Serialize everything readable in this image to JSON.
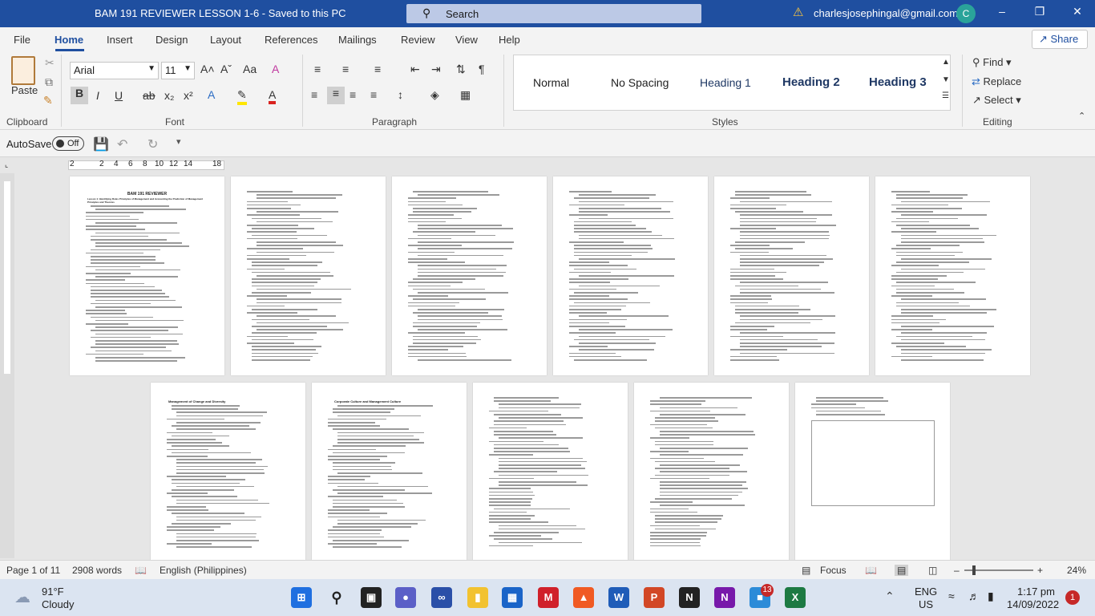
{
  "titlebar": {
    "doc_title": "BAM 191 REVIEWER LESSON 1-6  -  Saved to this PC",
    "search_label": "Search",
    "account_email": "charlesjosephingal@gmail.com",
    "avatar_initial": "C"
  },
  "menu": {
    "tabs": [
      "File",
      "Home",
      "Insert",
      "Design",
      "Layout",
      "References",
      "Mailings",
      "Review",
      "View",
      "Help"
    ],
    "share_label": "Share"
  },
  "ribbon": {
    "paste_label": "Paste",
    "font_name": "Arial",
    "font_size": "11",
    "styles": [
      "Normal",
      "No Spacing",
      "Heading 1",
      "Heading 2",
      "Heading 3"
    ],
    "editing": {
      "find": "Find",
      "replace": "Replace",
      "select": "Select"
    },
    "groups": [
      "Clipboard",
      "Font",
      "Paragraph",
      "Styles",
      "Editing"
    ]
  },
  "qat": {
    "autosave_label": "AutoSave",
    "autosave_state": "Off"
  },
  "ruler": {
    "labels": [
      "2",
      "2",
      "4",
      "6",
      "8",
      "10",
      "12",
      "14",
      "18"
    ]
  },
  "document": {
    "page1_title": "BAM 191 REVIEWER",
    "page1_subtitle": "Lesson 1: Identifying Roles Principles of Management and Accounting the Prediction of Management Principles and Theories",
    "page7_title": "Management of Change and Diversity",
    "page8_title": "Corporate Culture and Management Culture"
  },
  "status": {
    "page": "Page 1 of 11",
    "words": "2908 words",
    "language": "English (Philippines)",
    "focus": "Focus",
    "zoom": "24%"
  },
  "taskbar": {
    "weather_temp": "91°F",
    "weather_desc": "Cloudy",
    "lang1": "ENG",
    "lang2": "US",
    "time": "1:17 pm",
    "date": "14/09/2022",
    "teams_badge": "13",
    "notif_badge": "1"
  }
}
